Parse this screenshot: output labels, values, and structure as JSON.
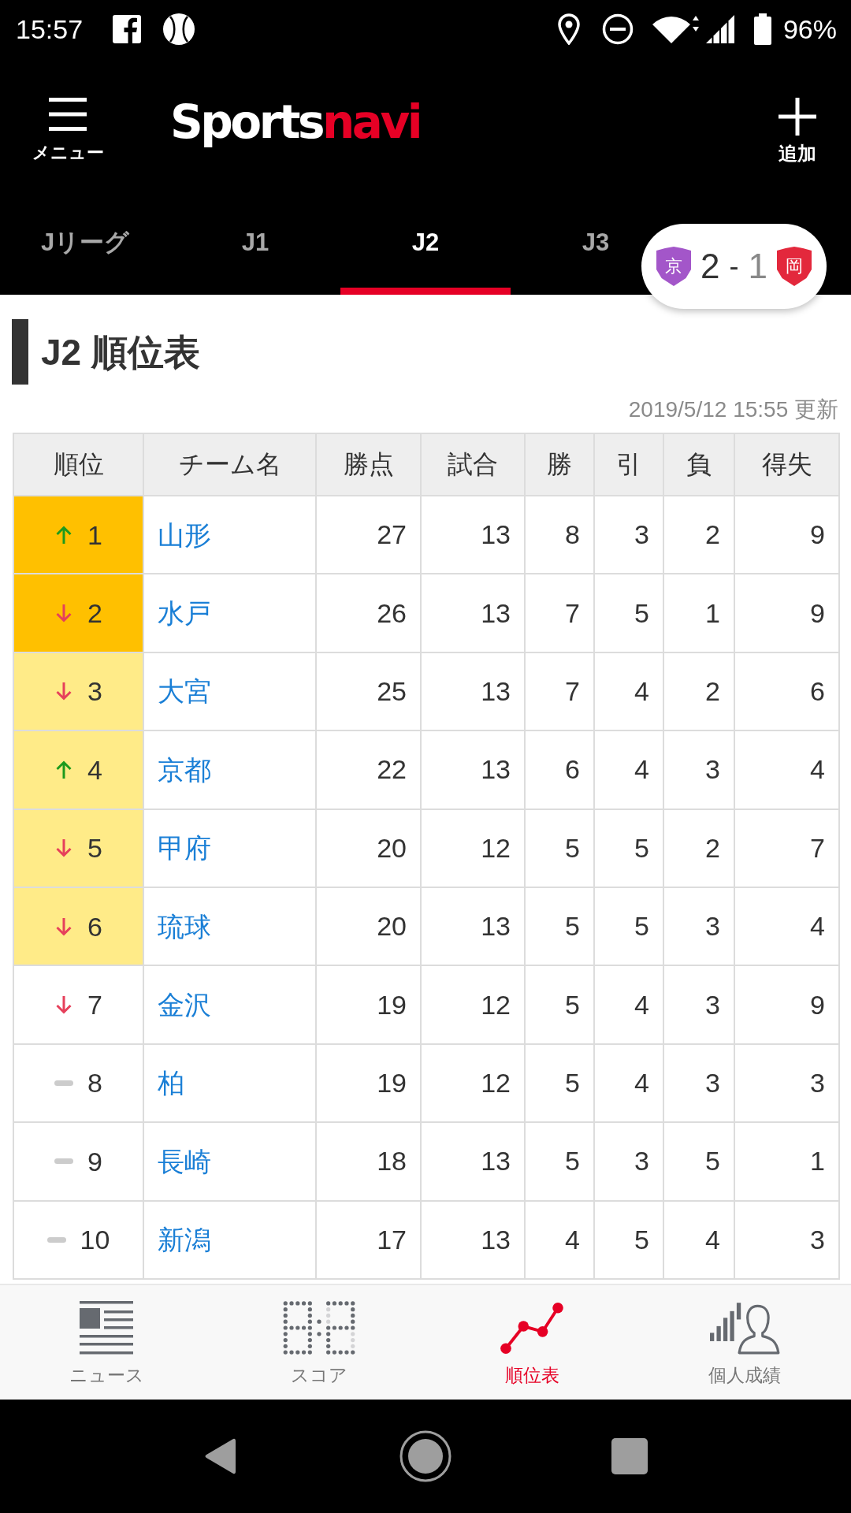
{
  "status_bar": {
    "time": "15:57",
    "battery": "96%"
  },
  "header": {
    "menu_label": "メニュー",
    "logo": {
      "main": "Sports",
      "accent": "navi"
    },
    "add_label": "追加"
  },
  "tabs": [
    {
      "label": "Jリーグ",
      "selected": false
    },
    {
      "label": "J1",
      "selected": false
    },
    {
      "label": "J2",
      "selected": true
    },
    {
      "label": "J3",
      "selected": false
    }
  ],
  "live_score": {
    "home": {
      "badge": "京",
      "color": "#a356c9",
      "score": "2",
      "leading": true
    },
    "separator": "-",
    "away": {
      "badge": "岡",
      "color": "#e3283c",
      "score": "1",
      "leading": false
    }
  },
  "page": {
    "title": "J2 順位表",
    "updated": "2019/5/12 15:55 更新"
  },
  "table": {
    "columns": [
      "順位",
      "チーム名",
      "勝点",
      "試合",
      "勝",
      "引",
      "負",
      "得失"
    ],
    "rows": [
      {
        "rank": "1",
        "trend": {
          "kind": "up"
        },
        "color": "#ffc000",
        "team": "山形",
        "values": [
          "27",
          "13",
          "8",
          "3",
          "2",
          "9"
        ]
      },
      {
        "rank": "2",
        "trend": {
          "kind": "down"
        },
        "color": "#ffc000",
        "team": "水戸",
        "values": [
          "26",
          "13",
          "7",
          "5",
          "1",
          "9"
        ]
      },
      {
        "rank": "3",
        "trend": {
          "kind": "down"
        },
        "color": "#ffeb88",
        "team": "大宮",
        "values": [
          "25",
          "13",
          "7",
          "4",
          "2",
          "6"
        ]
      },
      {
        "rank": "4",
        "trend": {
          "kind": "up"
        },
        "color": "#ffeb88",
        "team": "京都",
        "values": [
          "22",
          "13",
          "6",
          "4",
          "3",
          "4"
        ]
      },
      {
        "rank": "5",
        "trend": {
          "kind": "down"
        },
        "color": "#ffeb88",
        "team": "甲府",
        "values": [
          "20",
          "12",
          "5",
          "5",
          "2",
          "7"
        ]
      },
      {
        "rank": "6",
        "trend": {
          "kind": "down"
        },
        "color": "#ffeb88",
        "team": "琉球",
        "values": [
          "20",
          "13",
          "5",
          "5",
          "3",
          "4"
        ]
      },
      {
        "rank": "7",
        "trend": {
          "kind": "down"
        },
        "color": "#ffffff",
        "team": "金沢",
        "values": [
          "19",
          "12",
          "5",
          "4",
          "3",
          "9"
        ]
      },
      {
        "rank": "8",
        "trend": {
          "kind": "same"
        },
        "color": "#ffffff",
        "team": "柏",
        "values": [
          "19",
          "12",
          "5",
          "4",
          "3",
          "3"
        ]
      },
      {
        "rank": "9",
        "trend": {
          "kind": "same"
        },
        "color": "#ffffff",
        "team": "長崎",
        "values": [
          "18",
          "13",
          "5",
          "3",
          "5",
          "1"
        ]
      },
      {
        "rank": "10",
        "trend": {
          "kind": "same"
        },
        "color": "#ffffff",
        "team": "新潟",
        "values": [
          "17",
          "13",
          "4",
          "5",
          "4",
          "3"
        ]
      }
    ]
  },
  "bottom_nav": [
    {
      "label": "ニュース",
      "kind": "news",
      "selected": false
    },
    {
      "label": "スコア",
      "kind": "score",
      "selected": false
    },
    {
      "label": "順位表",
      "kind": "standings",
      "selected": true
    },
    {
      "label": "個人成績",
      "kind": "stats",
      "selected": false
    }
  ]
}
